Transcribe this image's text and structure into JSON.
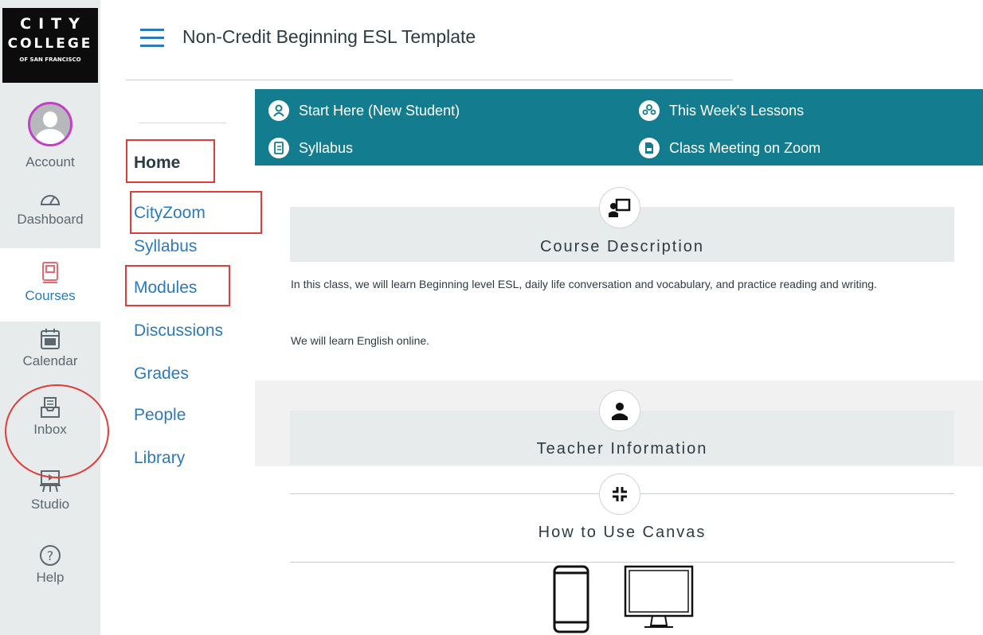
{
  "logo": {
    "line1": "CITY",
    "line2": "COLLEGE",
    "line3": "OF SAN FRANCISCO"
  },
  "global_nav": {
    "account": "Account",
    "dashboard": "Dashboard",
    "courses": "Courses",
    "calendar": "Calendar",
    "inbox": "Inbox",
    "studio": "Studio",
    "help": "Help",
    "active_item": "Courses",
    "icons": [
      "avatar",
      "dashboard-icon",
      "courses-icon",
      "calendar-icon",
      "inbox-icon",
      "studio-icon",
      "help-icon"
    ]
  },
  "header": {
    "course_title": "Non-Credit Beginning ESL Template"
  },
  "course_nav": {
    "items": [
      {
        "label": "Home",
        "active": true
      },
      {
        "label": "CityZoom"
      },
      {
        "label": "Syllabus"
      },
      {
        "label": "Modules"
      },
      {
        "label": "Discussions"
      },
      {
        "label": "Grades"
      },
      {
        "label": "People"
      },
      {
        "label": "Library"
      }
    ]
  },
  "banner": {
    "start_here": "Start Here (New Student)",
    "this_week": "This Week's Lessons",
    "syllabus": "Syllabus",
    "zoom": "Class Meeting on Zoom"
  },
  "sections": {
    "description": {
      "title": "Course Description",
      "p1": "In this class, we will learn Beginning level ESL, daily life conversation and vocabulary, and practice reading and writing.",
      "p2": "We will learn English online."
    },
    "teacher": {
      "title": "Teacher Information"
    },
    "canvas": {
      "title": "How to Use Canvas"
    }
  },
  "colors": {
    "banner": "#137c8e",
    "link": "#2b7abc",
    "annotation": "#e03c3c",
    "avatar_ring": "#c340c5",
    "nav_bg": "#e8ebec"
  }
}
